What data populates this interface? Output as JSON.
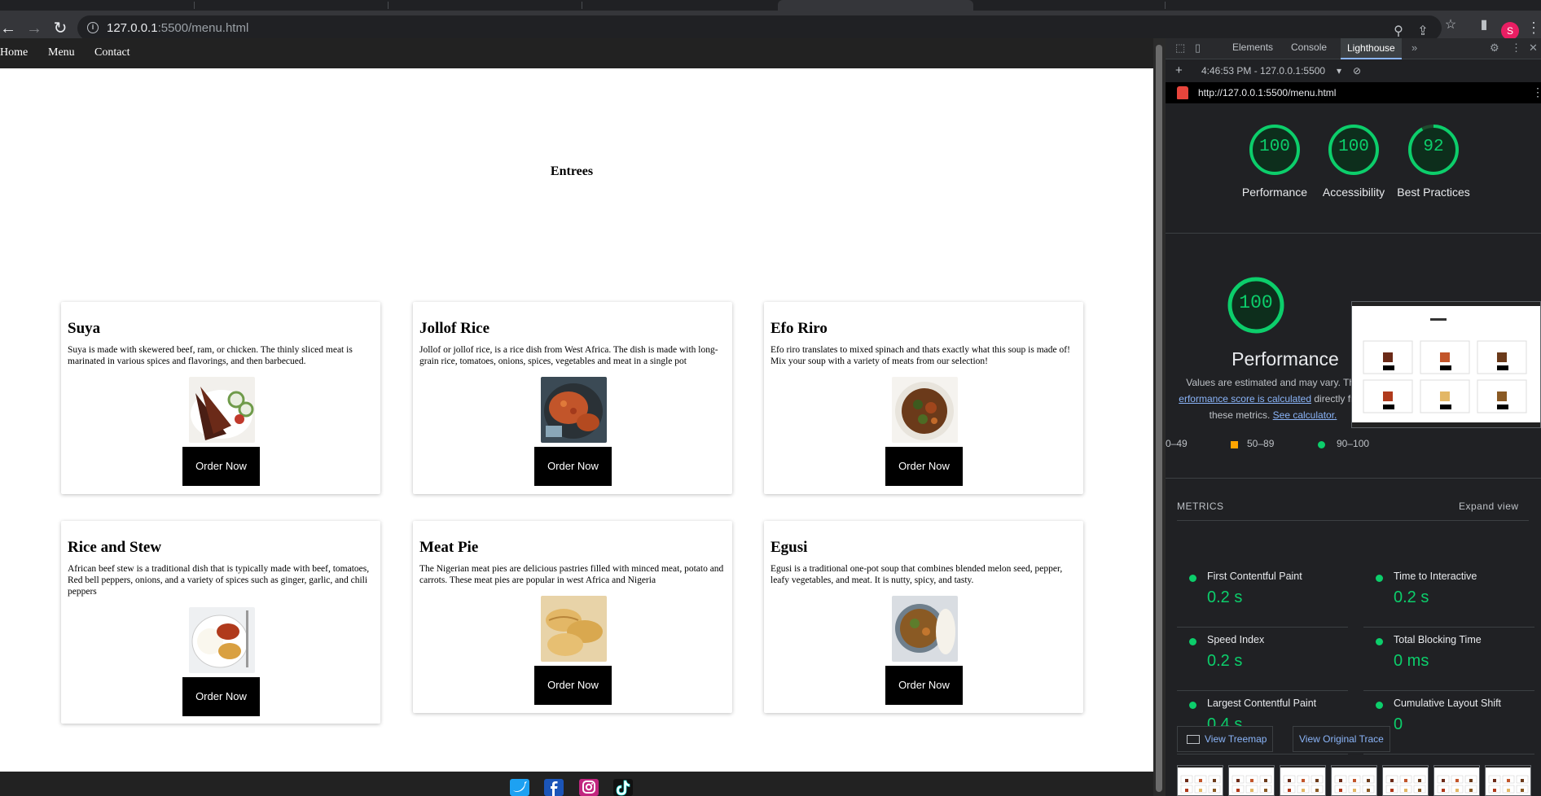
{
  "browser": {
    "url_host": "127.0.0.1",
    "url_rest": ":5500/menu.html",
    "avatar_letter": "S"
  },
  "site": {
    "nav": [
      "Home",
      "Menu",
      "Contact"
    ],
    "heading": "Entrees",
    "order_label": "Order Now",
    "dishes": [
      {
        "name": "Suya",
        "desc": "Suya is made with skewered beef, ram, or chicken. The thinly sliced meat is marinated in various spices and flavorings, and then barbecued."
      },
      {
        "name": "Jollof Rice",
        "desc": "Jollof or jollof rice, is a rice dish from West Africa. The dish is made with long-grain rice, tomatoes, onions, spices, vegetables and meat in a single pot"
      },
      {
        "name": "Efo Riro",
        "desc": "Efo riro translates to mixed spinach and thats exactly what this soup is made of! Mix your soup with a variety of meats from our selection!"
      },
      {
        "name": "Rice and Stew",
        "desc": "African beef stew is a traditional dish that is typically made with beef, tomatoes, Red bell peppers, onions, and a variety of spices such as ginger, garlic, and chili peppers"
      },
      {
        "name": "Meat Pie",
        "desc": "The Nigerian meat pies are delicious pastries filled with minced meat, potato and carrots. These meat pies are popular in west Africa and Nigeria"
      },
      {
        "name": "Egusi",
        "desc": "Egusi is a traditional one-pot soup that combines blended melon seed, pepper, leafy vegetables, and meat. It is nutty, spicy, and tasty."
      }
    ],
    "social_icons": [
      "twitter-icon",
      "facebook-icon",
      "instagram-icon",
      "tiktok-icon"
    ]
  },
  "devtools": {
    "tabs": [
      "Elements",
      "Console",
      "Lighthouse"
    ],
    "active_tab": "Lighthouse",
    "more": "»",
    "report_time": "4:46:53 PM - 127.0.0.1:5500",
    "report_url": "http://127.0.0.1:5500/menu.html",
    "gauges": [
      {
        "score": "100",
        "label": "Performance"
      },
      {
        "score": "100",
        "label": "Accessibility"
      },
      {
        "score": "92",
        "label": "Best Practices"
      }
    ],
    "perf_score": "100",
    "perf_title": "Performance",
    "perf_desc_1": "Values are estimated and may vary. The",
    "perf_link_1": "erformance score is calculated",
    "perf_desc_2": "directly from",
    "perf_desc_3": "these metrics.",
    "perf_link_2": "See calculator.",
    "legend": [
      "0–49",
      "50–89",
      "90–100"
    ],
    "metrics_label": "METRICS",
    "expand_label": "Expand view",
    "metrics": [
      {
        "name": "First Contentful Paint",
        "value": "0.2 s"
      },
      {
        "name": "Time to Interactive",
        "value": "0.2 s"
      },
      {
        "name": "Speed Index",
        "value": "0.2 s"
      },
      {
        "name": "Total Blocking Time",
        "value": "0 ms"
      },
      {
        "name": "Largest Contentful Paint",
        "value": "0.4 s"
      },
      {
        "name": "Cumulative Layout Shift",
        "value": "0"
      }
    ],
    "view_treemap": "View Treemap",
    "view_trace": "View Original Trace",
    "colors": {
      "good": "#0cce6b",
      "average": "#ffa400",
      "link": "#8ab4f8"
    }
  }
}
